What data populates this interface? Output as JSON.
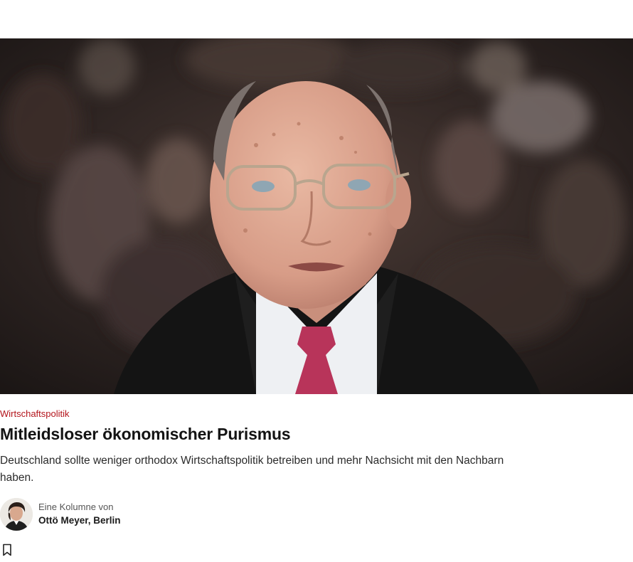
{
  "article": {
    "kicker": "Wirtschaftspolitik",
    "headline": "Mitleidsloser ökonomischer Purismus",
    "teaser": "Deutschland sollte weniger orthodox Wirtschaftspolitik betreiben und mehr Nachsicht mit den Nachbarn haben.",
    "byline": {
      "intro": "Eine Kolumne von",
      "author": "Ottö Meyer, Berlin"
    }
  },
  "icons": {
    "bookmark": "bookmark-icon"
  },
  "colors": {
    "kicker": "#b3141b",
    "headline": "#141414",
    "background": "#ffffff"
  }
}
